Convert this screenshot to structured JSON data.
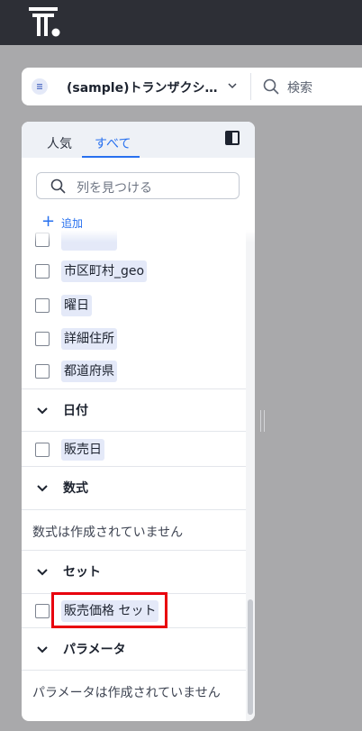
{
  "colors": {
    "accent": "#2770ef",
    "chip_bg": "#e4e9f8",
    "topbar": "#2d2f36",
    "highlight": "#e8000d"
  },
  "topbar": {
    "logo": "thoughtspot-logo"
  },
  "source_bar": {
    "source_name": "(sample)トランザクシ…",
    "search_placeholder": "検索"
  },
  "panel": {
    "tabs": [
      {
        "label": "人気"
      },
      {
        "label": "すべて",
        "active": true
      }
    ],
    "column_search_placeholder": "列を見つける",
    "add_label": "追加",
    "location_columns": [
      "市区町村_geo",
      "曜日",
      "詳細住所",
      "都道府県"
    ],
    "sections": {
      "date": {
        "label": "日付",
        "columns": [
          "販売日"
        ]
      },
      "formula": {
        "label": "数式",
        "empty_text": "数式は作成されていません"
      },
      "set": {
        "label": "セット",
        "columns": [
          "販売価格 セット"
        ]
      },
      "parameter": {
        "label": "パラメータ",
        "empty_text": "パラメータは作成されていません"
      }
    }
  }
}
